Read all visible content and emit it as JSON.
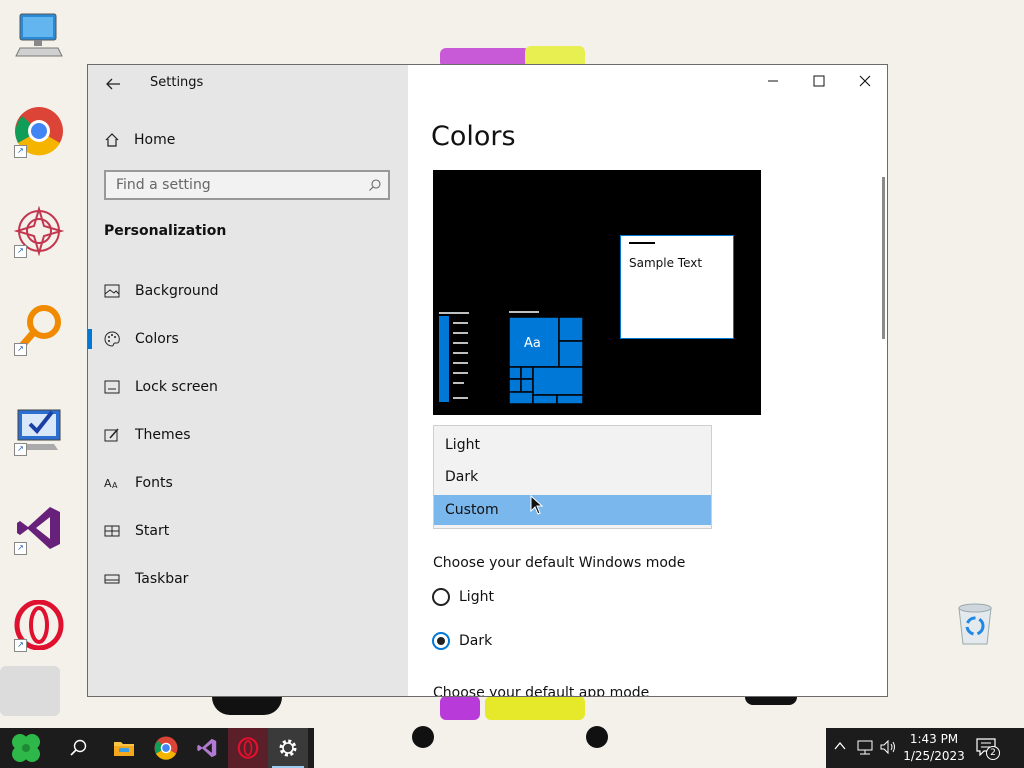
{
  "window": {
    "title": "Settings",
    "controls": {
      "minimize": "minimize",
      "maximize": "maximize",
      "close": "close"
    }
  },
  "sidebar": {
    "home_label": "Home",
    "search_placeholder": "Find a setting",
    "section_title": "Personalization",
    "items": [
      {
        "label": "Background",
        "icon": "picture-icon",
        "active": false
      },
      {
        "label": "Colors",
        "icon": "palette-icon",
        "active": true
      },
      {
        "label": "Lock screen",
        "icon": "lock-screen-icon",
        "active": false
      },
      {
        "label": "Themes",
        "icon": "brush-icon",
        "active": false
      },
      {
        "label": "Fonts",
        "icon": "font-icon",
        "active": false
      },
      {
        "label": "Start",
        "icon": "start-icon",
        "active": false
      },
      {
        "label": "Taskbar",
        "icon": "taskbar-icon",
        "active": false
      }
    ]
  },
  "main": {
    "page_title": "Colors",
    "preview": {
      "sample_text": "Sample Text",
      "tile_label": "Aa"
    },
    "color_dropdown": {
      "options": [
        "Light",
        "Dark",
        "Custom"
      ],
      "selected": "Custom"
    },
    "windows_mode": {
      "label": "Choose your default Windows mode",
      "options": [
        "Light",
        "Dark"
      ],
      "selected": "Dark"
    },
    "app_mode": {
      "label": "Choose your default app mode"
    }
  },
  "taskbar": {
    "pinned": [
      "start-button",
      "search-button",
      "file-explorer",
      "chrome",
      "visual-studio",
      "opera",
      "settings"
    ],
    "active": "settings",
    "clock": {
      "time": "1:43 PM",
      "date": "1/25/2023"
    },
    "notifications_count": "2"
  },
  "colors": {
    "accent": "#0078d7",
    "selection": "#7ab7ec",
    "sidebar_bg": "#e6e6e6"
  }
}
